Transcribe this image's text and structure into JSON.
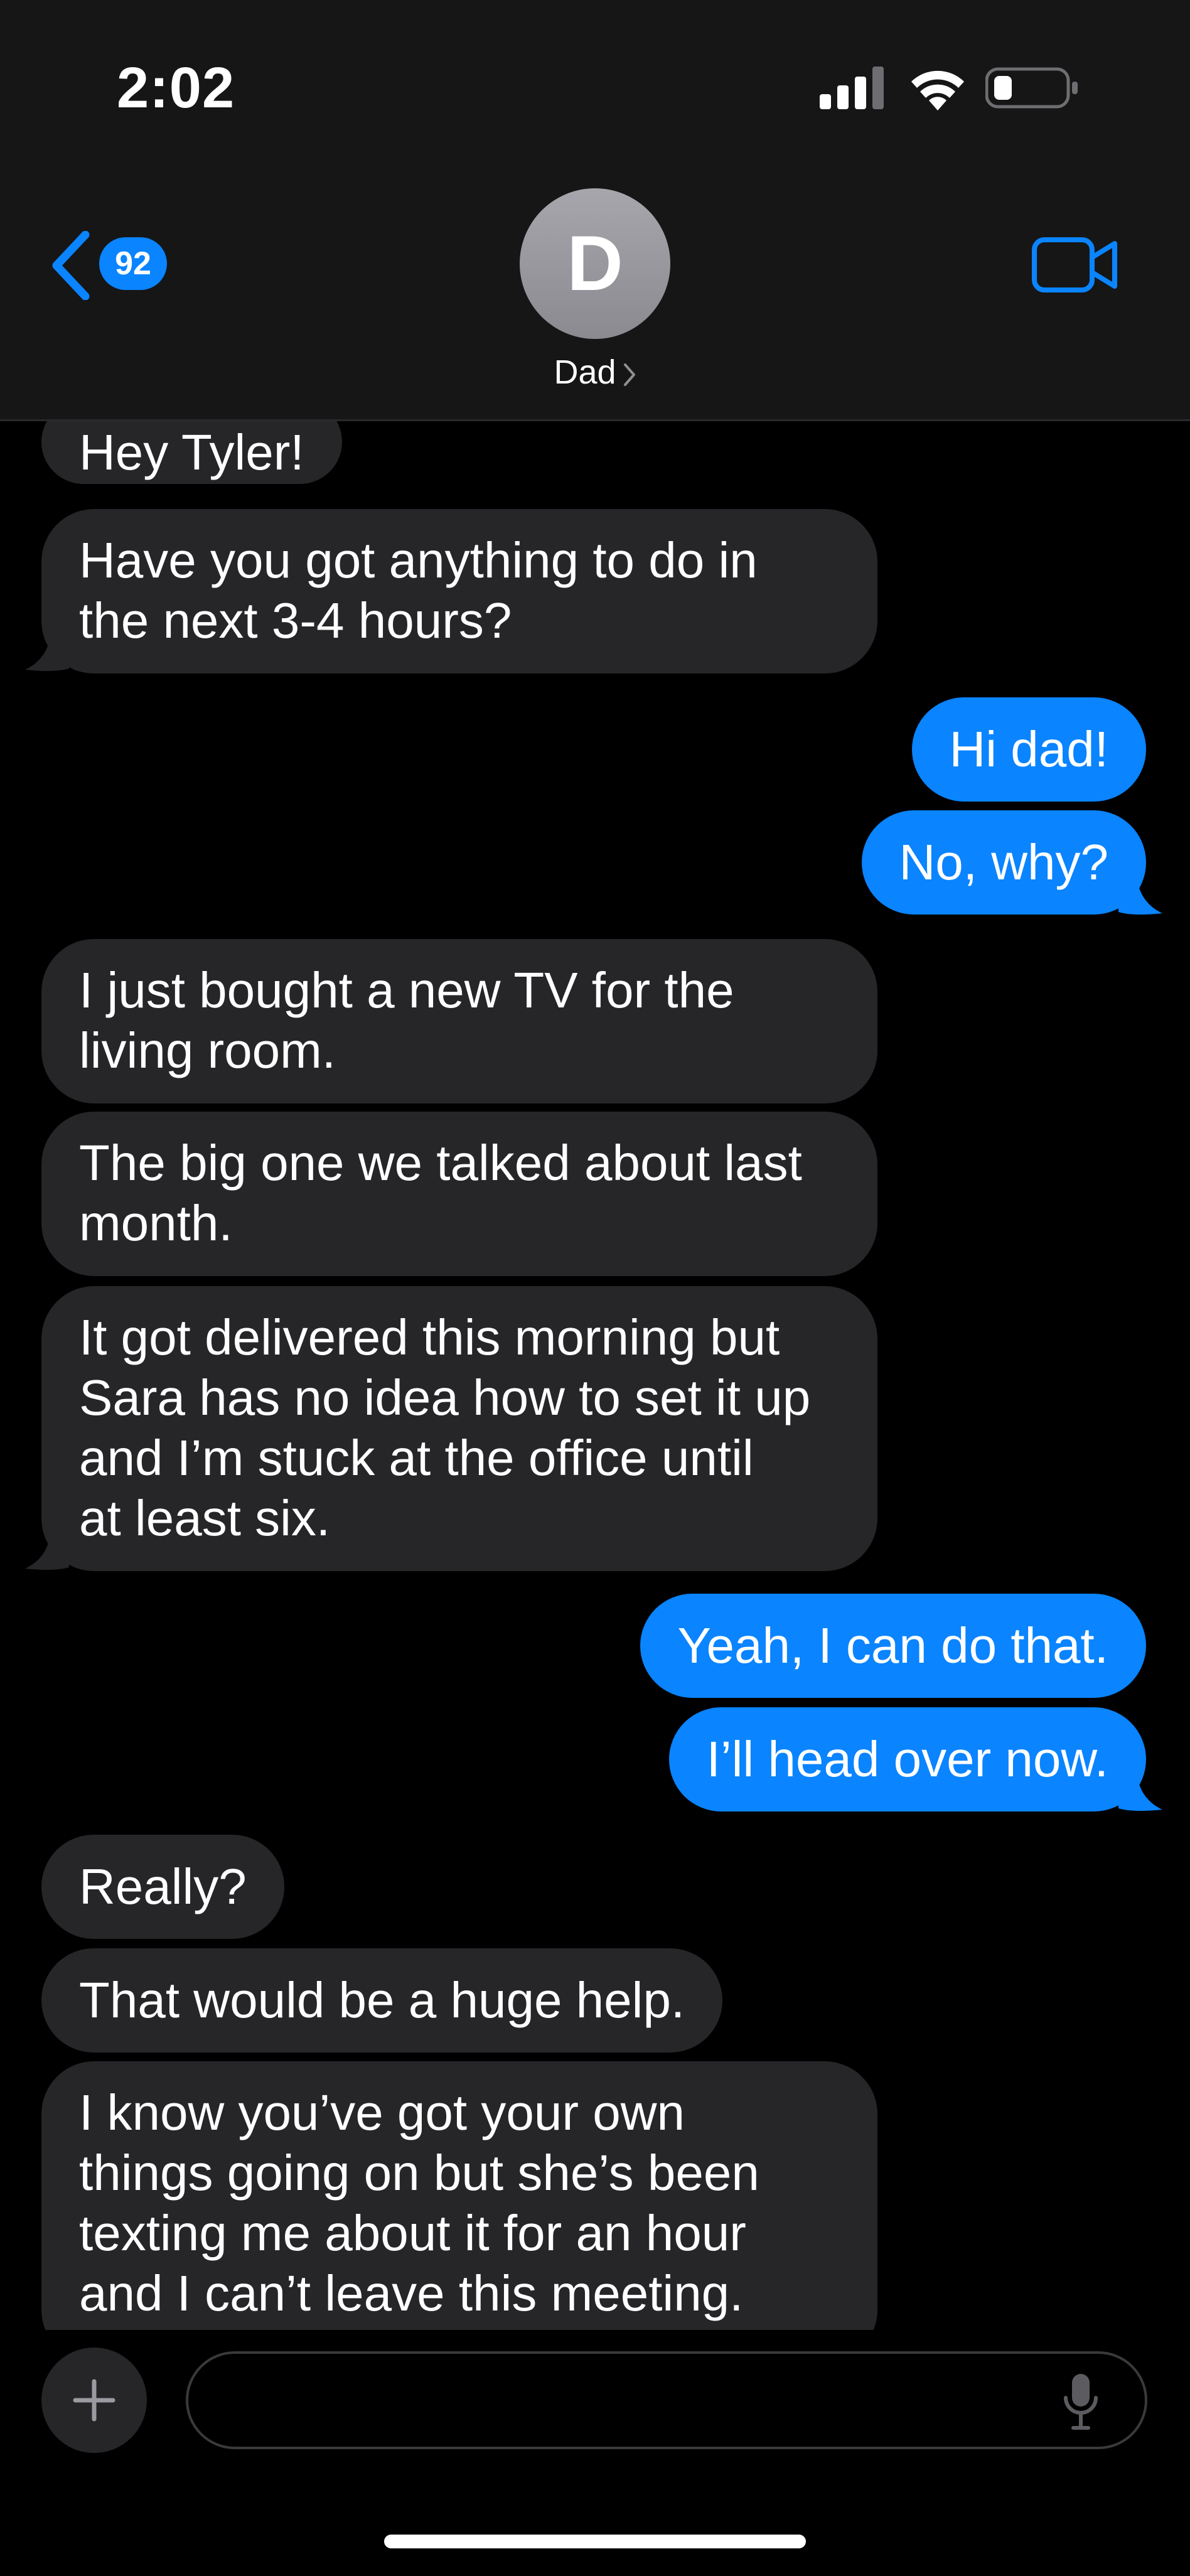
{
  "status_bar": {
    "time": "2:02",
    "icons": [
      "cellular-signal-icon",
      "wifi-icon",
      "battery-icon"
    ]
  },
  "header": {
    "back_badge_count": "92",
    "contact_initial": "D",
    "contact_name": "Dad",
    "icons": [
      "back-chevron-icon",
      "chevron-right-icon",
      "video-camera-icon"
    ]
  },
  "colors": {
    "accent": "#0a84ff",
    "incoming_bubble": "#262629",
    "background": "#000000",
    "header_background": "#161616"
  },
  "messages": [
    {
      "direction": "in",
      "lines": [
        "Hey Tyler!"
      ]
    },
    {
      "direction": "in",
      "lines": [
        "Have you got anything to do in",
        "the next 3-4 hours?"
      ]
    },
    {
      "direction": "out",
      "lines": [
        "Hi dad!"
      ]
    },
    {
      "direction": "out",
      "lines": [
        "No, why?"
      ]
    },
    {
      "direction": "in",
      "lines": [
        "I just bought a new TV for the",
        "living room."
      ]
    },
    {
      "direction": "in",
      "lines": [
        "The big one we talked about last",
        "month."
      ]
    },
    {
      "direction": "in",
      "lines": [
        "It got delivered this morning but",
        "Sara has no idea how to set it up",
        "and I’m stuck at the office until",
        "at least six."
      ]
    },
    {
      "direction": "out",
      "lines": [
        "Yeah, I can do that."
      ]
    },
    {
      "direction": "out",
      "lines": [
        "I’ll head over now."
      ]
    },
    {
      "direction": "in",
      "lines": [
        "Really?"
      ]
    },
    {
      "direction": "in",
      "lines": [
        "That would be a huge help."
      ]
    },
    {
      "direction": "in",
      "lines": [
        "I know you’ve got your own",
        "things going on but she’s been",
        "texting me about it for an hour",
        "and I can’t leave this meeting."
      ]
    }
  ],
  "composer": {
    "text_value": "",
    "icons": [
      "plus-icon",
      "microphone-icon"
    ]
  }
}
